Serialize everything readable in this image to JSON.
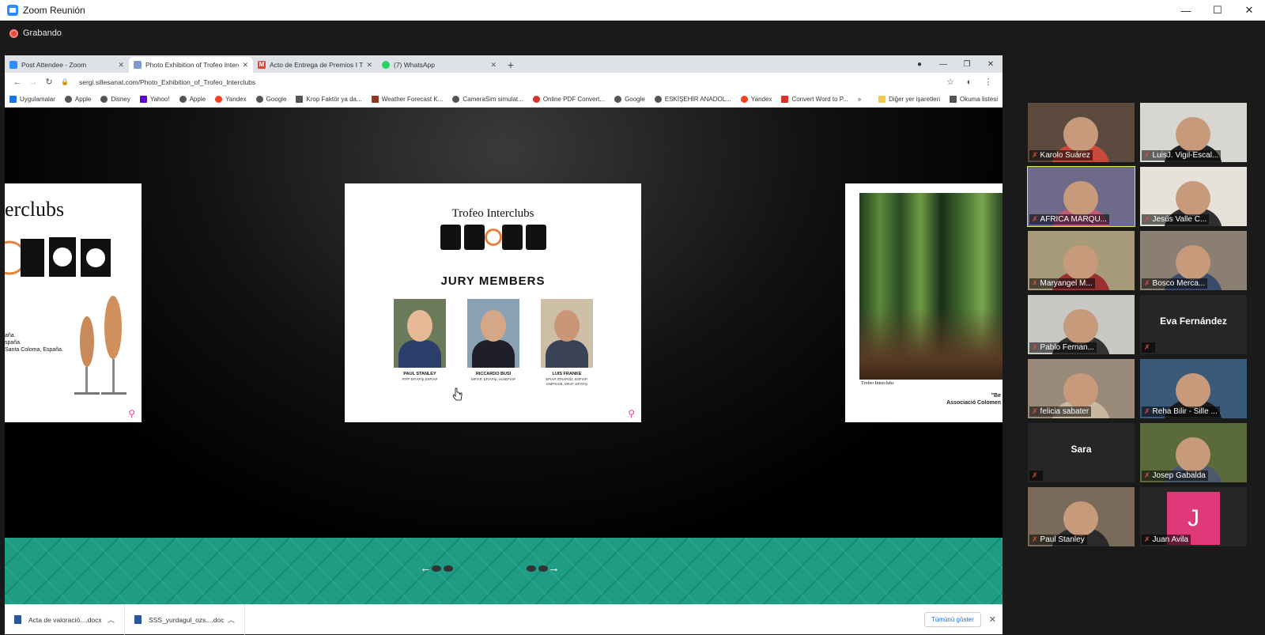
{
  "zoom": {
    "title": "Zoom Reunión",
    "recording": "Grabando",
    "win_ctrls": [
      "—",
      "☐",
      "✕"
    ]
  },
  "browser": {
    "tabs": [
      {
        "label": "Post Attendee - Zoom",
        "icon_color": "#2d8cff",
        "active": false
      },
      {
        "label": "Photo Exhibition of Trofeo Intercl",
        "icon_color": "#7b9bd1",
        "active": true
      },
      {
        "label": "Acto de Entrega de Premios I Trofe",
        "icon_color": "#d44638",
        "active": false
      },
      {
        "label": "(7) WhatsApp",
        "icon_color": "#25d366",
        "active": false
      }
    ],
    "url": "sergi.sillesanat.com/Photo_Exhibition_of_Trofeo_Interclubs",
    "bookmarks": [
      "Uygulamalar",
      "Apple",
      "Disney",
      "Yahoo!",
      "Apple",
      "Yandex",
      "Google",
      "Krop Faktör ya da...",
      "Weather Forecast K...",
      "CameraSim simulat...",
      "Online PDF Convert...",
      "Google",
      "ESKİŞEHİR ANADOL...",
      "Yandex",
      "Convert Word to P..."
    ],
    "bookmarks_more": "»",
    "bookmarks_right": [
      "Diğer yer işaretleri",
      "Okuma listesi"
    ]
  },
  "exhibit": {
    "center": {
      "title": "Trofeo Interclubs",
      "heading": "JURY MEMBERS",
      "jury": [
        {
          "name": "PAUL STANLEY",
          "title": "FIPF EFIAP/p ESFIAP"
        },
        {
          "name": "RICCARDO BUSI",
          "title": "MFIAP, EFIAP/p, HonEFIAP"
        },
        {
          "name": "LUIS FRANKE",
          "title": "EFIAP, EFIAP/d2, ESFIAP, GMPSA/B, MFAF, EFAF/p"
        }
      ]
    },
    "left": {
      "title": "erclubs",
      "text_lines": [
        "aña.",
        "",
        "spaña.",
        "Santa Coloma, España."
      ]
    },
    "right": {
      "logo_text": "Trofeo Interclubs",
      "caption_lines": [
        "\"Be",
        "Associació Colomen"
      ]
    }
  },
  "downloads": {
    "items": [
      "Acta de valoració....docx",
      "SSS_yurdagul_ozs....doc"
    ],
    "show_all": "Tümünü göster"
  },
  "participants": [
    {
      "name": "Karolo Suárez",
      "col": 0,
      "row": 0
    },
    {
      "name": "LuisJ. Vigil-Escal...",
      "col": 1,
      "row": 0
    },
    {
      "name": "AFRICA MARQU...",
      "col": 0,
      "row": 1,
      "active": true
    },
    {
      "name": "Jesús Valle C...",
      "col": 1,
      "row": 1
    },
    {
      "name": "Maryangel M...",
      "col": 0,
      "row": 2
    },
    {
      "name": "Bosco Merca...",
      "col": 1,
      "row": 2
    },
    {
      "name": "Pablo Fernan...",
      "col": 0,
      "row": 3
    },
    {
      "name": "Eva Fernández",
      "col": 1,
      "row": 3,
      "video_off": true
    },
    {
      "name": "felicia sabater",
      "col": 0,
      "row": 4
    },
    {
      "name": "Reha Bilir - Sille ...",
      "col": 1,
      "row": 4
    },
    {
      "name": "Sara",
      "col": 0,
      "row": 5,
      "video_off": true
    },
    {
      "name": "Josep Gabalda",
      "col": 1,
      "row": 5
    },
    {
      "name": "Paul Stanley",
      "col": 0,
      "row": 6
    },
    {
      "name": "Juan Avila",
      "col": 1,
      "row": 6,
      "avatar": "J"
    }
  ]
}
